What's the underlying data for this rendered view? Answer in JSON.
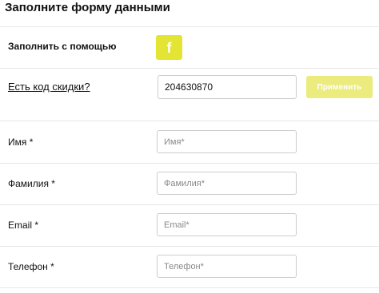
{
  "form": {
    "title": "Заполните форму данными",
    "fill_with_label": "Заполнить с помощью",
    "facebook_glyph": "f",
    "discount_link": "Есть код скидки?",
    "discount_value": "204630870",
    "apply_label": "Применить",
    "fields": {
      "first_name": {
        "label": "Имя *",
        "placeholder": "Имя*"
      },
      "last_name": {
        "label": "Фамилия *",
        "placeholder": "Фамилия*"
      },
      "email": {
        "label": "Email *",
        "placeholder": "Email*"
      },
      "phone": {
        "label": "Телефон *",
        "placeholder": "Телефон*"
      }
    }
  },
  "colors": {
    "facebook_button": "#e4e432",
    "apply_button": "#ebeb7e",
    "divider": "#e6e6e6"
  },
  "icons": {
    "facebook": "facebook-icon"
  }
}
